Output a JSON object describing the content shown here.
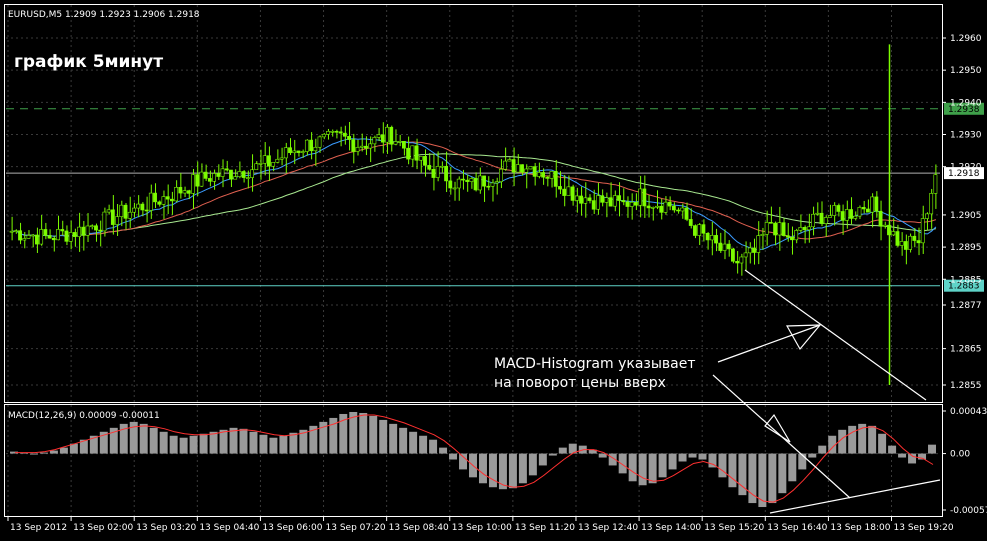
{
  "header": {
    "symbol_info": "EURUSD,M5  1.2909 1.2923 1.2906 1.2918",
    "overlay_title": "график 5минут"
  },
  "macd": {
    "label": "MACD(12,26,9) 0.00009 -0.00011",
    "ticks": [
      "0.00043",
      "0.00",
      "-0.00057"
    ]
  },
  "annotation": {
    "line1": "MACD-Histogram указывает",
    "line2": "на поворот цены вверх"
  },
  "colors": {
    "background": "#000000",
    "border": "#ffffff",
    "candles": "#7cfc00",
    "ma_fast": "#3b9cff",
    "ma_mid": "#e06050",
    "ma_slow": "#a8e890",
    "level_line": "#5fd3c8",
    "dashed_line": "#3fa04a",
    "histogram": "#9a9a9a",
    "signal": "#ff3030",
    "annotation": "#ffffff"
  },
  "chart_data": [
    {
      "type": "candlestick",
      "y_ticks": [
        "1.2960",
        "1.2950",
        "1.2940",
        "1.2930",
        "1.2920",
        "1.2905",
        "1.2895",
        "1.2885",
        "1.2877",
        "1.2865",
        "1.2855"
      ],
      "x_labels": [
        "13 Sep 2012",
        "13 Sep 02:00",
        "13 Sep 03:20",
        "13 Sep 04:40",
        "13 Sep 06:00",
        "13 Sep 07:20",
        "13 Sep 08:40",
        "13 Sep 10:00",
        "13 Sep 11:20",
        "13 Sep 12:40",
        "13 Sep 14:00",
        "13 Sep 15:20",
        "13 Sep 16:40",
        "13 Sep 18:00",
        "13 Sep 19:20"
      ],
      "hlines": [
        {
          "value": 1.2938,
          "label": "1.2938",
          "style": "dashed"
        },
        {
          "value": 1.2918,
          "label": "1.2918",
          "style": "solid"
        },
        {
          "value": 1.2883,
          "label": "1.2883",
          "style": "solid"
        }
      ],
      "close_path": [
        1.29,
        1.2899,
        1.2898,
        1.2899,
        1.29,
        1.2902,
        1.2904,
        1.2906,
        1.2908,
        1.291,
        1.2912,
        1.2915,
        1.2917,
        1.2918,
        1.2919,
        1.292,
        1.2922,
        1.2925,
        1.2927,
        1.2928,
        1.2929,
        1.2927,
        1.2928,
        1.293,
        1.2925,
        1.292,
        1.2918,
        1.2915,
        1.2914,
        1.2917,
        1.292,
        1.2921,
        1.2919,
        1.2916,
        1.2912,
        1.291,
        1.2909,
        1.2908,
        1.2911,
        1.2909,
        1.2908,
        1.2903,
        1.2898,
        1.2894,
        1.289,
        1.2893,
        1.2903,
        1.2897,
        1.29,
        1.2905,
        1.2905,
        1.2906,
        1.2909,
        1.2902,
        1.2895,
        1.2897,
        1.2918
      ]
    },
    {
      "type": "bar",
      "name": "MACD(12,26,9)",
      "ylim": [
        -0.00057,
        0.00043
      ],
      "histogram": [
        2e-05,
        1e-05,
        0.0,
        1e-05,
        3e-05,
        6e-05,
        0.0001,
        0.00014,
        0.00018,
        0.00022,
        0.00026,
        0.0003,
        0.00032,
        0.0003,
        0.00026,
        0.00022,
        0.00018,
        0.00016,
        0.00018,
        0.0002,
        0.00022,
        0.00024,
        0.00026,
        0.00025,
        0.00022,
        0.00019,
        0.00016,
        0.00018,
        0.00021,
        0.00024,
        0.00028,
        0.00032,
        0.00036,
        0.0004,
        0.00042,
        0.00041,
        0.00038,
        0.00034,
        0.0003,
        0.00026,
        0.00022,
        0.00018,
        0.00014,
        6e-05,
        -6e-05,
        -0.00016,
        -0.00024,
        -0.0003,
        -0.00034,
        -0.00036,
        -0.00035,
        -0.0003,
        -0.00022,
        -0.00012,
        -2e-05,
        6e-05,
        0.0001,
        8e-05,
        4e-05,
        -4e-05,
        -0.00012,
        -0.0002,
        -0.00028,
        -0.00032,
        -0.0003,
        -0.00024,
        -0.00016,
        -8e-05,
        -4e-05,
        -6e-05,
        -0.00014,
        -0.00024,
        -0.00034,
        -0.00042,
        -0.0005,
        -0.00054,
        -0.0005,
        -0.0004,
        -0.00028,
        -0.00016,
        -4e-05,
        8e-05,
        0.00018,
        0.00024,
        0.00028,
        0.0003,
        0.00028,
        0.0002,
        8e-05,
        -4e-05,
        -0.0001,
        -6e-05,
        9e-05
      ],
      "signal": [
        1e-05,
        1e-05,
        1e-05,
        2e-05,
        4e-05,
        7e-05,
        0.0001,
        0.00013,
        0.00016,
        0.00019,
        0.00022,
        0.00025,
        0.00027,
        0.00028,
        0.00027,
        0.00025,
        0.00022,
        0.0002,
        0.00019,
        0.00019,
        0.0002,
        0.00022,
        0.00023,
        0.00024,
        0.00023,
        0.00021,
        0.00019,
        0.00018,
        0.00019,
        0.00021,
        0.00024,
        0.00027,
        0.0003,
        0.00034,
        0.00037,
        0.00039,
        0.00039,
        0.00037,
        0.00034,
        0.00031,
        0.00027,
        0.00023,
        0.00019,
        0.00013,
        5e-05,
        -4e-05,
        -0.00013,
        -0.00021,
        -0.00027,
        -0.00032,
        -0.00034,
        -0.00033,
        -0.00029,
        -0.00022,
        -0.00014,
        -6e-05,
        1e-05,
        4e-05,
        4e-05,
        1e-05,
        -5e-05,
        -0.00012,
        -0.00019,
        -0.00025,
        -0.00028,
        -0.00027,
        -0.00022,
        -0.00016,
        -0.0001,
        -8e-05,
        -0.00011,
        -0.00018,
        -0.00026,
        -0.00034,
        -0.00042,
        -0.00048,
        -0.00049,
        -0.00045,
        -0.00037,
        -0.00027,
        -0.00016,
        -4e-05,
        7e-05,
        0.00016,
        0.00022,
        0.00026,
        0.00027,
        0.00023,
        0.00015,
        5e-05,
        -3e-05,
        -5e-05,
        -0.00011
      ]
    }
  ]
}
